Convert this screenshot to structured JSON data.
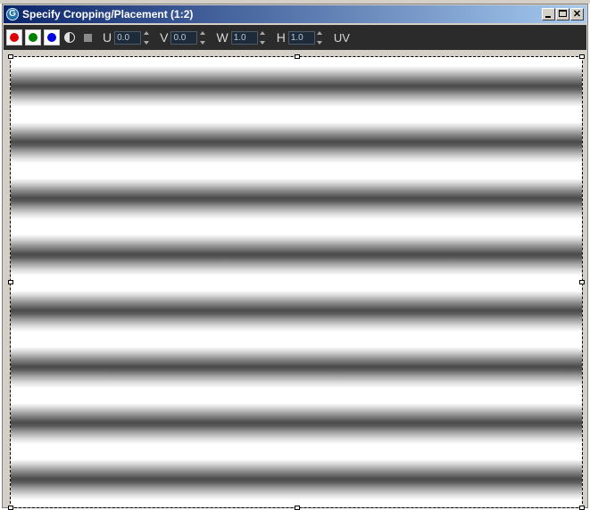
{
  "window": {
    "title": "Specify Cropping/Placement (1:2)",
    "app_icon_glyph": "G",
    "buttons": [
      "minimize",
      "maximize",
      "close"
    ],
    "close_glyph": "✕"
  },
  "toolbar": {
    "channels": [
      {
        "name": "red",
        "color": "#e00000"
      },
      {
        "name": "green",
        "color": "#008000"
      },
      {
        "name": "blue",
        "color": "#0000e0"
      }
    ],
    "fields": [
      {
        "label": "U",
        "value": "0.0"
      },
      {
        "label": "V",
        "value": "0.0"
      },
      {
        "label": "W",
        "value": "1.0"
      },
      {
        "label": "H",
        "value": "1.0"
      }
    ],
    "uv_label": "UV"
  },
  "canvas": {
    "pattern": "horizontal-grayscale-stripes",
    "colors": {
      "light": "#ffffff",
      "dark": "#4a4a4a"
    }
  }
}
